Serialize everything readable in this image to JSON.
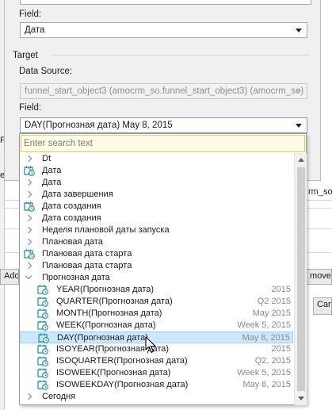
{
  "source": {
    "field_label": "Field:",
    "field_value": "Дата"
  },
  "target": {
    "group_label": "Target",
    "datasource_label": "Data Source:",
    "datasource_value": "funnel_start_object3 (amocrm_so.funnel_start_object3) (amocrm_so)",
    "field_label": "Field:",
    "field_value": "DAY(Прогнозная дата) May 8, 2015"
  },
  "dropdown": {
    "search_placeholder": "Enter search text",
    "items": [
      {
        "label": "Dt",
        "value": "",
        "kind": "collapsed"
      },
      {
        "label": "Дата",
        "value": "",
        "kind": "date-collapsed"
      },
      {
        "label": "Дата",
        "value": "",
        "kind": "collapsed"
      },
      {
        "label": "Дата завершения",
        "value": "",
        "kind": "collapsed"
      },
      {
        "label": "Дата создания",
        "value": "",
        "kind": "date-collapsed"
      },
      {
        "label": "Дата создания",
        "value": "",
        "kind": "collapsed"
      },
      {
        "label": "Неделя плановой даты запуска",
        "value": "",
        "kind": "collapsed"
      },
      {
        "label": "Плановая дата",
        "value": "",
        "kind": "collapsed"
      },
      {
        "label": "Плановая дата старта",
        "value": "",
        "kind": "date-collapsed"
      },
      {
        "label": "Плановая дата старта",
        "value": "",
        "kind": "collapsed"
      },
      {
        "label": "Прогнозная дата",
        "value": "",
        "kind": "expanded"
      },
      {
        "label": "YEAR(Прогнозная дата)",
        "value": "2015",
        "kind": "child"
      },
      {
        "label": "QUARTER(Прогнозная дата)",
        "value": "Q2 2015",
        "kind": "child"
      },
      {
        "label": "MONTH(Прогнозная дата)",
        "value": "May 2015",
        "kind": "child"
      },
      {
        "label": "WEEK(Прогнозная дата)",
        "value": "Week 5, 2015",
        "kind": "child"
      },
      {
        "label": "DAY(Прогнозная дата)",
        "value": "May 8, 2015",
        "kind": "child",
        "selected": true
      },
      {
        "label": "ISOYEAR(Прогнозная дата)",
        "value": "2015",
        "kind": "child"
      },
      {
        "label": "ISOQUARTER(Прогнозная дата)",
        "value": "Q2, 2015",
        "kind": "child"
      },
      {
        "label": "ISOWEEK(Прогнозная дата)",
        "value": "Week 5, 2015",
        "kind": "child"
      },
      {
        "label": "ISOWEEKDAY(Прогнозная дата)",
        "value": "May 8, 2015",
        "kind": "child"
      },
      {
        "label": "Сегодня",
        "value": "",
        "kind": "collapsed"
      }
    ]
  },
  "background": {
    "left_fragment_1": "F",
    "left_fragment_2": "e",
    "right_fragment": "rm_so",
    "add_button": "Add F",
    "remove_button": "move",
    "cancel_button": "Can"
  },
  "colors": {
    "selection": "#cce8ff",
    "search_bg": "#fdfbe3",
    "calendar_icon": "#1e8a9c"
  }
}
